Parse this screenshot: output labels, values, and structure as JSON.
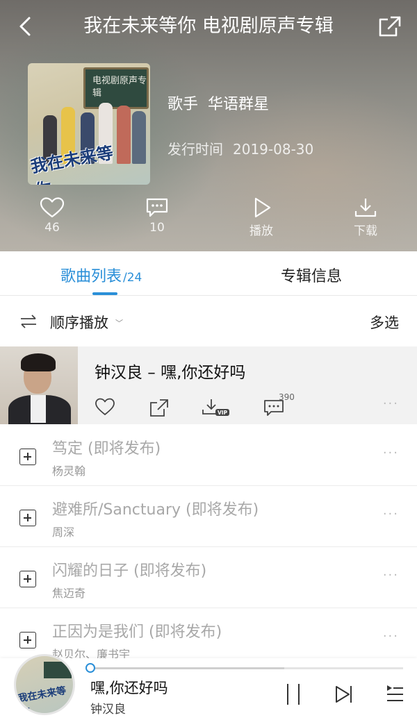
{
  "nav": {
    "title": "我在未来等你 电视剧原声专辑"
  },
  "album": {
    "cover_text": "电视剧原声专辑",
    "cover_title": "我在未来等你",
    "artist_label": "歌手",
    "artist": "华语群星",
    "date_label": "发行时间",
    "date": "2019-08-30"
  },
  "actions": {
    "like_count": "46",
    "comment_count": "10",
    "play_label": "播放",
    "download_label": "下载"
  },
  "tabs": {
    "songs_label": "歌曲列表",
    "songs_count": "/24",
    "info_label": "专辑信息"
  },
  "playmode": {
    "order_label": "顺序播放",
    "multi_label": "多选"
  },
  "current_song": {
    "title": "钟汉良 – 嘿,你还好吗",
    "comment_count": "390",
    "download_badge": "VIP"
  },
  "songs": [
    {
      "title": "笃定 (即将发布)",
      "artist": "杨灵翰"
    },
    {
      "title": "避难所/Sanctuary (即将发布)",
      "artist": "周深"
    },
    {
      "title": "闪耀的日子 (即将发布)",
      "artist": "焦迈奇"
    },
    {
      "title": "正因为是我们 (即将发布)",
      "artist": "赵贝尔、廉书宇"
    }
  ],
  "player": {
    "title": "嘿,你还好吗",
    "artist": "钟汉良",
    "progress": 0.62
  },
  "colors": {
    "accent": "#2a8fd8"
  }
}
